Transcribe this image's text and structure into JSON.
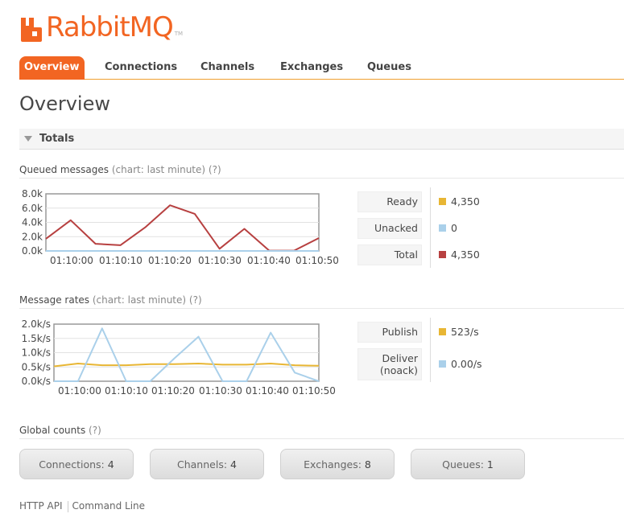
{
  "logo": {
    "text": "RabbitMQ",
    "tm": "TM",
    "color": "#f26522"
  },
  "nav": {
    "tabs": [
      {
        "label": "Overview",
        "active": true
      },
      {
        "label": "Connections",
        "active": false
      },
      {
        "label": "Channels",
        "active": false
      },
      {
        "label": "Exchanges",
        "active": false
      },
      {
        "label": "Queues",
        "active": false
      }
    ]
  },
  "page_title": "Overview",
  "totals": {
    "section_label": "Totals",
    "queued": {
      "title": "Queued messages",
      "aux": "(chart: last minute)",
      "help": "(?)",
      "legend": [
        {
          "label": "Ready",
          "value": "4,350",
          "color": "#e8b634"
        },
        {
          "label": "Unacked",
          "value": "0",
          "color": "#aad0ea"
        },
        {
          "label": "Total",
          "value": "4,350",
          "color": "#b74040"
        }
      ]
    },
    "rates": {
      "title": "Message rates",
      "aux": "(chart: last minute)",
      "help": "(?)",
      "legend": [
        {
          "label": "Publish",
          "value": "523/s",
          "color": "#e8b634"
        },
        {
          "label": "Deliver",
          "label2": "(noack)",
          "value": "0.00/s",
          "color": "#aad0ea"
        }
      ]
    }
  },
  "global_counts": {
    "title": "Global counts",
    "help": "(?)",
    "items": [
      {
        "label": "Connections:",
        "value": "4"
      },
      {
        "label": "Channels:",
        "value": "4"
      },
      {
        "label": "Exchanges:",
        "value": "8"
      },
      {
        "label": "Queues:",
        "value": "1"
      }
    ]
  },
  "footer": {
    "links": [
      "HTTP API",
      "Command Line"
    ]
  },
  "chart_data": [
    {
      "type": "line",
      "title": "Queued messages",
      "x": [
        "01:10:00",
        "01:10:05",
        "01:10:10",
        "01:10:15",
        "01:10:20",
        "01:10:25",
        "01:10:30",
        "01:10:35",
        "01:10:40",
        "01:10:45",
        "01:10:50"
      ],
      "x_ticks": [
        "01:10:00",
        "01:10:10",
        "01:10:20",
        "01:10:30",
        "01:10:40",
        "01:10:50"
      ],
      "y_ticks": [
        "8.0k",
        "6.0k",
        "4.0k",
        "2.0k",
        "0.0k"
      ],
      "ylim": [
        0,
        8000
      ],
      "grid": true,
      "series": [
        {
          "name": "Total",
          "color": "#b74040",
          "values": [
            1700,
            4300,
            1000,
            800,
            3300,
            6400,
            5200,
            300,
            3100,
            50,
            50,
            1800
          ]
        },
        {
          "name": "Ready",
          "color": "#e8b634",
          "values": [
            0,
            0,
            0,
            0,
            0,
            0,
            0,
            0,
            0,
            0,
            0,
            0
          ]
        },
        {
          "name": "Unacked",
          "color": "#aad0ea",
          "values": [
            0,
            0,
            0,
            0,
            0,
            0,
            0,
            0,
            0,
            0,
            0,
            0
          ]
        }
      ]
    },
    {
      "type": "line",
      "title": "Message rates",
      "x_ticks": [
        "01:10:00",
        "01:10:10",
        "01:10:20",
        "01:10:30",
        "01:10:40",
        "01:10:50"
      ],
      "y_ticks": [
        "2.0k/s",
        "1.5k/s",
        "1.0k/s",
        "0.5k/s",
        "0.0k/s"
      ],
      "ylim": [
        0,
        2000
      ],
      "grid": true,
      "series": [
        {
          "name": "Publish",
          "color": "#e8b634",
          "values": [
            520,
            620,
            560,
            560,
            600,
            600,
            620,
            580,
            580,
            620,
            560,
            540
          ]
        },
        {
          "name": "Deliver (noack)",
          "color": "#aad0ea",
          "values": [
            0,
            0,
            1850,
            0,
            0,
            800,
            1560,
            0,
            0,
            1700,
            300,
            0
          ]
        }
      ]
    }
  ]
}
